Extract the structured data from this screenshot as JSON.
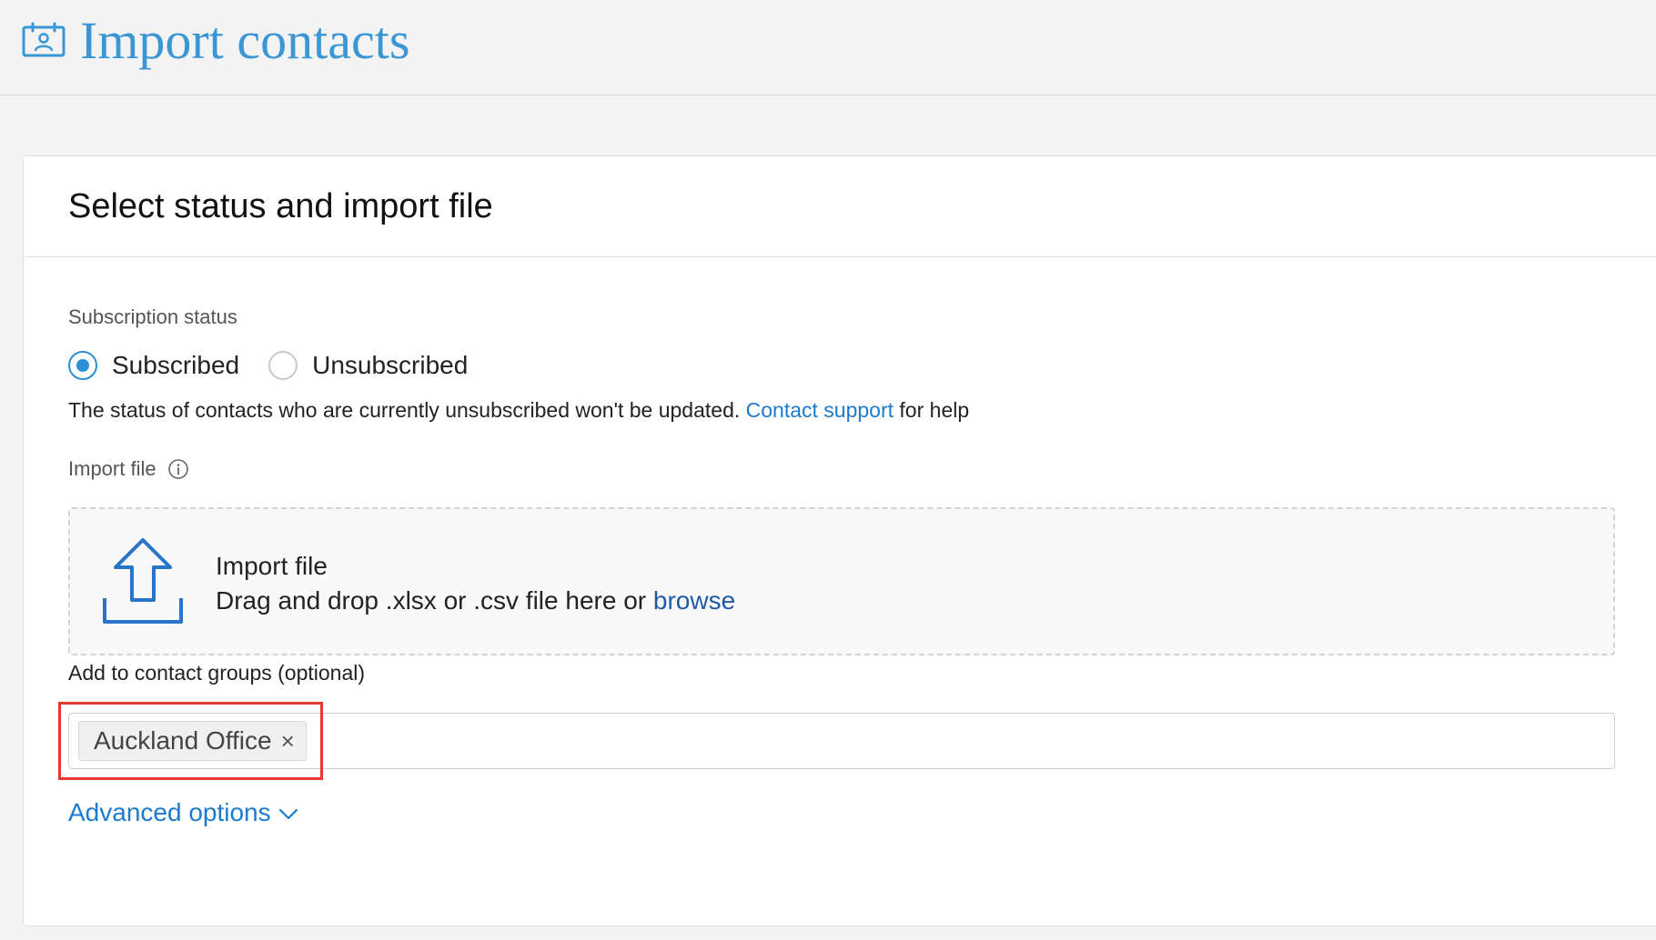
{
  "header": {
    "icon": "contact-card-calendar-icon",
    "title": "Import contacts",
    "accent_color": "#3a97d4"
  },
  "card": {
    "title": "Select status and import file"
  },
  "subscription": {
    "label": "Subscription status",
    "options": [
      {
        "label": "Subscribed",
        "checked": true
      },
      {
        "label": "Unsubscribed",
        "checked": false
      }
    ],
    "note_prefix": "The status of contacts who are currently unsubscribed won't be updated.",
    "note_link": "Contact support",
    "note_suffix": "for help"
  },
  "import_file": {
    "label": "Import file",
    "info_icon": "info-icon",
    "drop_title": "Import file",
    "drop_text": "Drag and drop .xlsx or .csv file here or",
    "browse_label": "browse",
    "upload_icon": "upload-arrow-icon"
  },
  "groups": {
    "label": "Add to contact groups (optional)",
    "tags": [
      {
        "label": "Auckland Office",
        "remove_glyph": "×"
      }
    ],
    "highlight_color": "#e53a2e"
  },
  "advanced": {
    "label": "Advanced options",
    "icon": "chevron-down-icon"
  },
  "colors": {
    "link": "#1a7bd0",
    "browse": "#1f5aa8",
    "radio_selected": "#2b8fd6"
  }
}
